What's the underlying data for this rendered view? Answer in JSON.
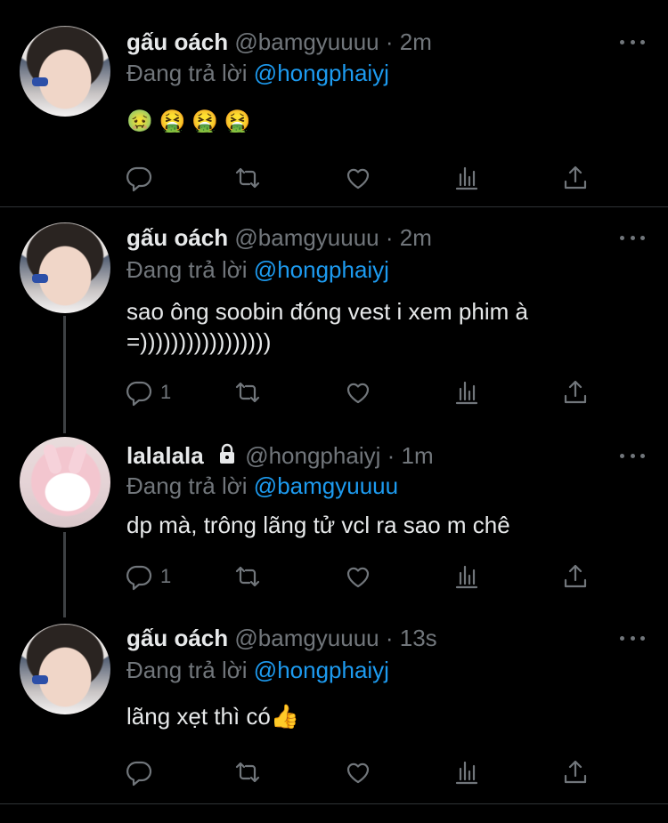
{
  "tweets": [
    {
      "name": "gấu oách",
      "handle": "@bamgyuuuu",
      "time": "2m",
      "reply_prefix": "Đang trả lời",
      "reply_to": "@hongphaiyj",
      "text": "🤢 🤮 🤮 🤮",
      "reply_count": "",
      "avatar_icon": "avatar-boy"
    },
    {
      "name": "gấu oách",
      "handle": "@bamgyuuuu",
      "time": "2m",
      "reply_prefix": "Đang trả lời",
      "reply_to": "@hongphaiyj",
      "text_line1": "sao ông soobin đóng vest i xem phim à",
      "text_line2": "=)))))))))))))))))",
      "reply_count": "1",
      "avatar_icon": "avatar-boy"
    },
    {
      "name": "lalalala",
      "handle": "@hongphaiyj",
      "time": "1m",
      "reply_prefix": "Đang trả lời",
      "reply_to": "@bamgyuuuu",
      "text": "dp mà, trông lãng tử vcl ra sao m chê",
      "reply_count": "1",
      "avatar_icon": "avatar-girl",
      "protected_icon": "lock-icon"
    },
    {
      "name": "gấu oách",
      "handle": "@bamgyuuuu",
      "time": "13s",
      "reply_prefix": "Đang trả lời",
      "reply_to": "@hongphaiyj",
      "text": "lãng xẹt thì có👍",
      "reply_count": "",
      "avatar_icon": "avatar-boy"
    }
  ],
  "sep": " · ",
  "colors": {
    "background": "#000000",
    "text": "#e7e9ea",
    "muted": "#71767b",
    "mention": "#1d9bf0",
    "divider": "#2f3336"
  },
  "action_icons": [
    "reply-icon",
    "retweet-icon",
    "like-icon",
    "analytics-icon",
    "share-icon"
  ]
}
